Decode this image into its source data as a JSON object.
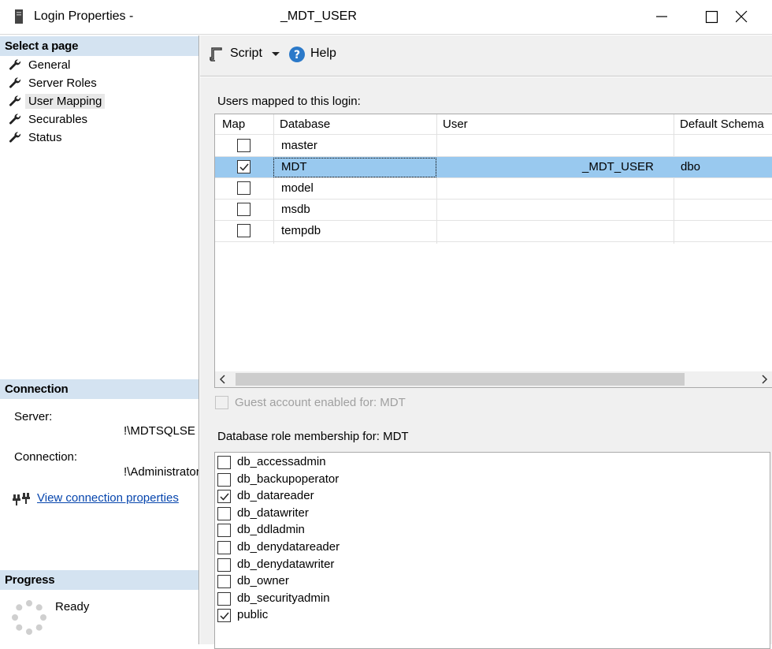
{
  "window": {
    "title_prefix": "Login Properties -",
    "title_suffix": "_MDT_USER"
  },
  "left": {
    "select_page_header": "Select a page",
    "pages": [
      {
        "label": "General",
        "selected": false
      },
      {
        "label": "Server Roles",
        "selected": false
      },
      {
        "label": "User Mapping",
        "selected": true
      },
      {
        "label": "Securables",
        "selected": false
      },
      {
        "label": "Status",
        "selected": false
      }
    ],
    "connection_header": "Connection",
    "server_label": "Server:",
    "server_value": "!\\MDTSQLSE",
    "connection_label": "Connection:",
    "connection_value": "!\\Administrator",
    "view_connection_link": "View connection properties",
    "progress_header": "Progress",
    "progress_status": "Ready"
  },
  "toolbar": {
    "script_label": "Script",
    "help_label": "Help"
  },
  "mapping": {
    "section_label": "Users mapped to this login:",
    "columns": [
      "Map",
      "Database",
      "User",
      "Default Schema"
    ],
    "rows": [
      {
        "map": false,
        "database": "master",
        "user": "",
        "schema": ""
      },
      {
        "map": true,
        "database": "MDT",
        "user": "_MDT_USER",
        "schema": "dbo"
      },
      {
        "map": false,
        "database": "model",
        "user": "",
        "schema": ""
      },
      {
        "map": false,
        "database": "msdb",
        "user": "",
        "schema": ""
      },
      {
        "map": false,
        "database": "tempdb",
        "user": "",
        "schema": ""
      }
    ]
  },
  "guest_label": "Guest account enabled for: MDT",
  "roles_label": "Database role membership for: MDT",
  "roles": [
    {
      "name": "db_accessadmin",
      "checked": false
    },
    {
      "name": "db_backupoperator",
      "checked": false
    },
    {
      "name": "db_datareader",
      "checked": true
    },
    {
      "name": "db_datawriter",
      "checked": false
    },
    {
      "name": "db_ddladmin",
      "checked": false
    },
    {
      "name": "db_denydatareader",
      "checked": false
    },
    {
      "name": "db_denydatawriter",
      "checked": false
    },
    {
      "name": "db_owner",
      "checked": false
    },
    {
      "name": "db_securityadmin",
      "checked": false
    },
    {
      "name": "public",
      "checked": true
    }
  ]
}
